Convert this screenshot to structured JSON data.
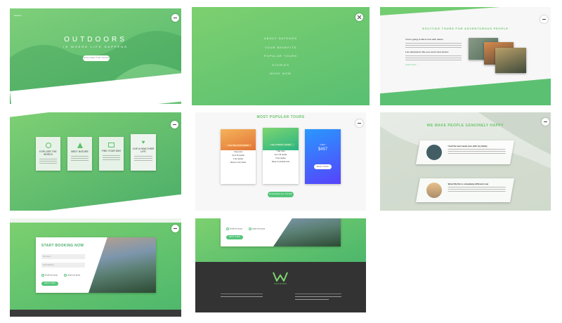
{
  "hero": {
    "logo": "Natours",
    "title": "OUTDOORS",
    "subtitle": "IS WHERE LIFE HAPPENS",
    "cta": "DISCOVER OUR TOURS"
  },
  "menu": {
    "items": [
      "ABOUT NATOURS",
      "YOUR BENEFITS",
      "POPULAR TOURS",
      "STORIES",
      "BOOK NOW"
    ]
  },
  "about": {
    "heading": "EXCITING TOURS FOR ADVENTUROUS PEOPLE",
    "sub1": "You're going to fall in love with nature",
    "sub2": "Live adventures like you never have before",
    "link": "Learn more →"
  },
  "features": {
    "items": [
      {
        "title": "EXPLORE THE WORLD",
        "icon": "globe-icon"
      },
      {
        "title": "MEET NATURE",
        "icon": "tree-icon"
      },
      {
        "title": "FIND YOUR WAY",
        "icon": "map-icon"
      },
      {
        "title": "LIVE A HEALTHIER LIFE",
        "icon": "heart-icon"
      }
    ]
  },
  "tours": {
    "heading": "MOST POPULAR TOURS",
    "cards": [
      {
        "title": "THE SEA EXPLORER",
        "detail": [
          "3 day tours",
          "Up to 30 people",
          "2 tour guides",
          "Sleep in cozy hotels"
        ]
      },
      {
        "title": "THE FOREST HIKER",
        "detail": [
          "7 day tours",
          "Up to 40 people",
          "6 tour guides",
          "Sleep in provided tents"
        ]
      },
      {
        "title": "ONLY",
        "price": "$497",
        "cta": "BOOK NOW!"
      }
    ],
    "cta": "DISCOVER ALL TOURS"
  },
  "stories": {
    "heading": "WE MAKE PEOPLE GENUINELY HAPPY",
    "items": [
      {
        "title": "I had the best week ever with my family"
      },
      {
        "title": "Wow! My life is completely different now"
      }
    ]
  },
  "booking": {
    "heading": "START BOOKING NOW",
    "fields": [
      "Full name",
      "Email address"
    ],
    "options": [
      "Small tour group",
      "Large tour group"
    ],
    "cta": "NEXT STEP"
  },
  "footer": {
    "logo": "NATOURS"
  },
  "colors": {
    "green_light": "#7ed56f",
    "green_dark": "#28b485",
    "blue_light": "#2998ff",
    "blue_dark": "#5643fa",
    "footer_bg": "#333333"
  }
}
